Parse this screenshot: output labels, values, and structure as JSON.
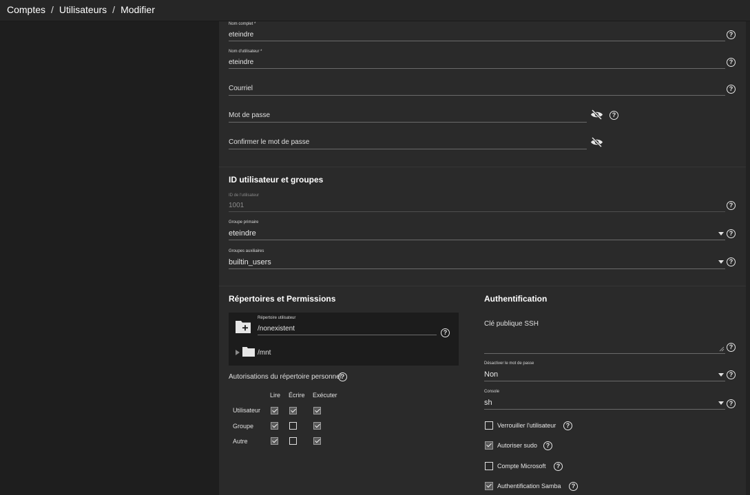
{
  "breadcrumb": {
    "items": [
      "Comptes",
      "Utilisateurs",
      "Modifier"
    ],
    "separator": "/"
  },
  "identity": {
    "full_name": {
      "label": "Nom complet *",
      "value": "eteindre"
    },
    "username": {
      "label": "Nom d'utilisateur *",
      "value": "eteindre"
    },
    "email": {
      "label": "Courriel",
      "value": ""
    },
    "password": {
      "label": "Mot de passe",
      "value": ""
    },
    "confirm_password": {
      "label": "Confirmer le mot de passe",
      "value": ""
    }
  },
  "ids_groups": {
    "title": "ID utilisateur et groupes",
    "uid": {
      "label": "ID de l'utilisateur",
      "value": "1001"
    },
    "primary_group": {
      "label": "Groupe primaire",
      "value": "eteindre"
    },
    "aux_groups": {
      "label": "Groupes auxiliaires",
      "value": "builtin_users"
    }
  },
  "directories": {
    "title": "Répertoires et Permissions",
    "home_dir": {
      "label": "Répertoire utilisateur",
      "value": "/nonexistent"
    },
    "tree_item": "/mnt",
    "perm_title": "Autorisations du répertoire personnel",
    "perm_headers": [
      "Lire",
      "Écrire",
      "Exécuter"
    ],
    "perm_rows": [
      {
        "label": "Utilisateur",
        "values": [
          true,
          true,
          true
        ]
      },
      {
        "label": "Groupe",
        "values": [
          true,
          false,
          true
        ]
      },
      {
        "label": "Autre",
        "values": [
          true,
          false,
          true
        ]
      }
    ]
  },
  "auth": {
    "title": "Authentification",
    "ssh_key": {
      "label": "Clé publique SSH",
      "value": ""
    },
    "disable_password": {
      "label": "Désactiver le mot de passe",
      "value": "Non"
    },
    "shell": {
      "label": "Console",
      "value": "sh"
    },
    "checkboxes": [
      {
        "label": "Verrouiller l'utilisateur",
        "checked": false
      },
      {
        "label": "Autoriser sudo",
        "checked": true
      },
      {
        "label": "Compte Microsoft",
        "checked": false
      },
      {
        "label": "Authentification Samba",
        "checked": true
      }
    ]
  }
}
